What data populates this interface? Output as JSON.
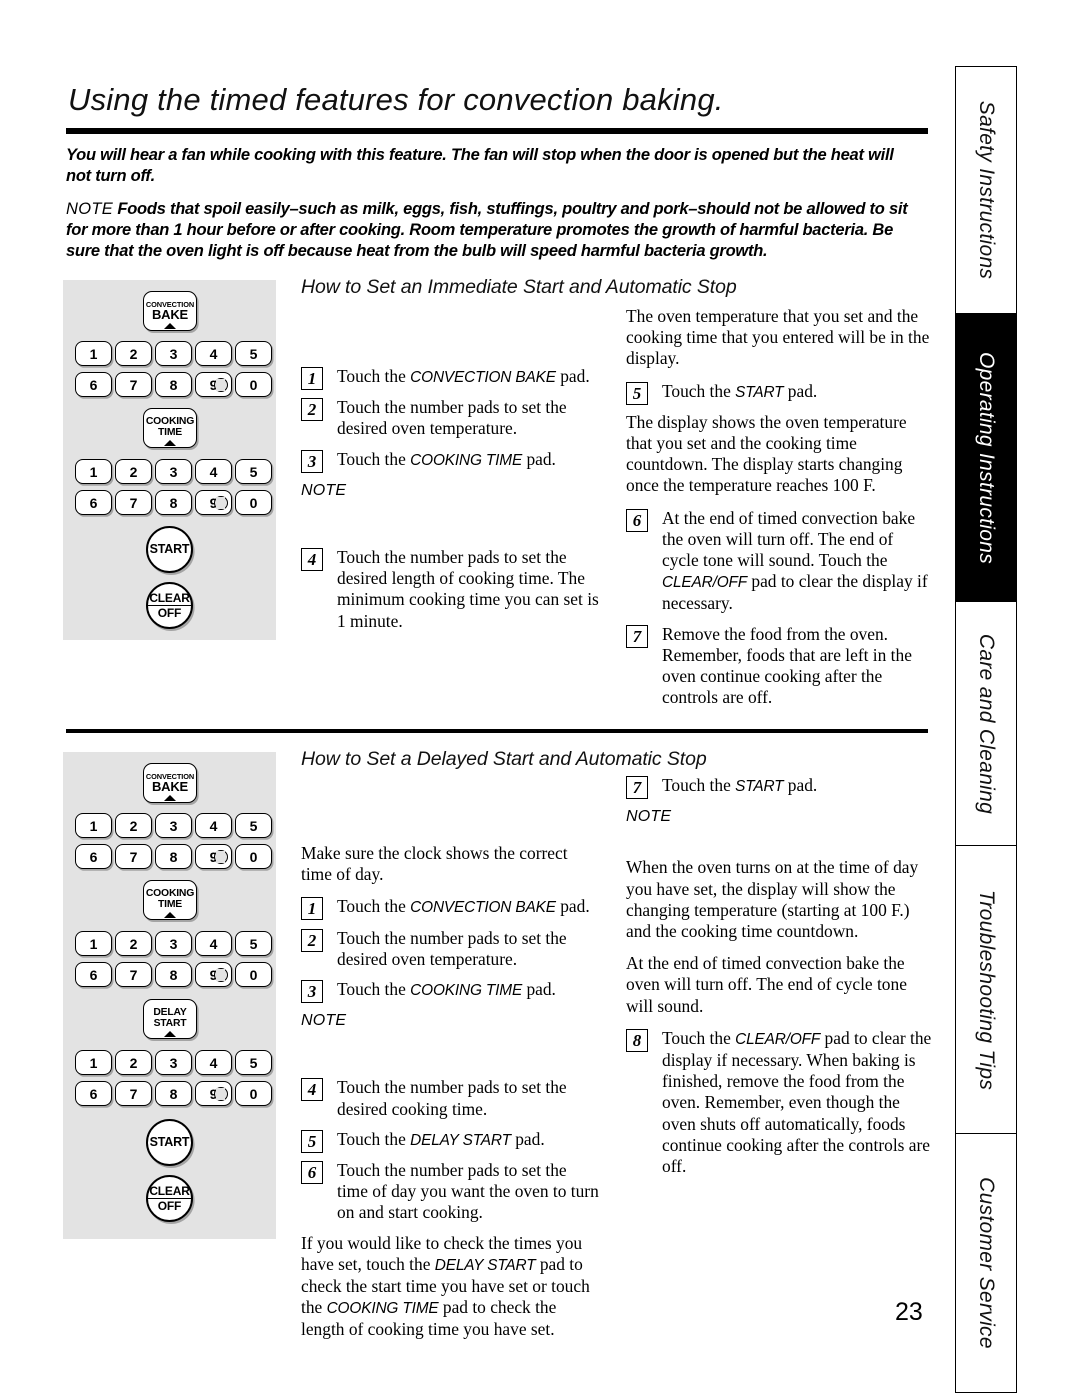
{
  "page": {
    "title": "Using the timed features for convection baking.",
    "number": "23"
  },
  "intro": {
    "paragraph1": "You will hear a fan while cooking with this feature. The fan will stop when the door is opened but the heat will not turn off.",
    "note_label": "NOTE",
    "paragraph2": "Foods that spoil easily–such as milk, eggs, fish, stuffings, poultry and pork–should not be allowed to sit for more than 1 hour before or after cooking. Room temperature promotes the growth of harmful bacteria. Be sure that the oven light is off because heat from the bulb will speed harmful bacteria growth."
  },
  "section1": {
    "heading": "How to Set an Immediate Start and Automatic Stop",
    "note_label": "NOTE",
    "steps_left": [
      {
        "num": "1",
        "pre": "Touch the ",
        "pad": "CONVECTION BAKE",
        "post": " pad."
      },
      {
        "num": "2",
        "pre": "Touch the number pads to set the desired oven temperature.",
        "pad": "",
        "post": ""
      },
      {
        "num": "3",
        "pre": "Touch the ",
        "pad": "COOKING TIME",
        "post": " pad."
      },
      {
        "num": "4",
        "pre": "Touch the number pads to set the desired length of cooking time. The minimum cooking time you can set is 1 minute.",
        "pad": "",
        "post": ""
      }
    ],
    "right_intro": "The oven temperature that you set and the cooking time that you entered will be in the display.",
    "step5": {
      "num": "5",
      "pre": "Touch the ",
      "pad": "START",
      "post": " pad."
    },
    "right_para2": "The display shows the oven temperature that you set and the cooking time countdown. The display starts changing once the temperature reaches 100  F.",
    "step6": {
      "num": "6",
      "pre": "At the end of timed convection bake the oven will turn off. The end of cycle tone will sound. Touch the ",
      "pad": "CLEAR/OFF",
      "post": " pad to clear the display if necessary."
    },
    "step7": {
      "num": "7",
      "pre": "Remove the food from the oven. Remember, foods that are left in the oven continue cooking after the controls are off.",
      "pad": "",
      "post": ""
    }
  },
  "section2": {
    "heading": "How to Set a Delayed Start and Automatic Stop",
    "note_label": "NOTE",
    "clock_para": "Make sure the clock shows the correct time of day.",
    "steps_left": [
      {
        "num": "1",
        "pre": "Touch the ",
        "pad": "CONVECTION BAKE",
        "post": " pad."
      },
      {
        "num": "2",
        "pre": "Touch the number pads to set the desired oven temperature.",
        "pad": "",
        "post": ""
      },
      {
        "num": "3",
        "pre": "Touch the ",
        "pad": "COOKING TIME",
        "post": " pad."
      },
      {
        "num": "4",
        "pre": "Touch the number pads to set the desired cooking time.",
        "pad": "",
        "post": ""
      },
      {
        "num": "5",
        "pre": "Touch the ",
        "pad": "DELAY START",
        "post": " pad."
      },
      {
        "num": "6",
        "pre": "Touch the number pads to set the time of day you want the oven to turn on and start cooking.",
        "pad": "",
        "post": ""
      }
    ],
    "check_para_1": "If you would like to check the times you have set, touch the ",
    "check_pad_1": "DELAY START",
    "check_para_2": " pad to check the start time you have set or touch the ",
    "check_pad_2": "COOKING TIME",
    "check_para_3": " pad to check the length of cooking time you have set.",
    "step7": {
      "num": "7",
      "pre": "Touch the ",
      "pad": "START",
      "post": " pad."
    },
    "right_para1": "When the oven turns on at the time of day you have set, the display will show the changing temperature (starting at 100  F.) and the cooking time countdown.",
    "right_para2": "At the end of timed convection bake the oven will turn off. The end of cycle tone will sound.",
    "step8": {
      "num": "8",
      "pre": "Touch the ",
      "pad": "CLEAR/OFF",
      "post": " pad to clear the display if necessary. When baking is finished, remove the food from the oven. Remember, even though the oven shuts off automatically, foods continue cooking after the controls are off."
    }
  },
  "control_panel_1": {
    "function_keys": [
      {
        "line1": "CONVECTION",
        "line2": "BAKE"
      },
      {
        "line1": "COOKING",
        "line2": "TIME"
      }
    ],
    "keypad_rows": [
      [
        "1",
        "2",
        "3",
        "4",
        "5"
      ],
      [
        "6",
        "7",
        "8",
        "9",
        "0"
      ]
    ],
    "start_label": "START",
    "clear_label_top": "CLEAR",
    "clear_label_bottom": "OFF"
  },
  "control_panel_2": {
    "function_keys": [
      {
        "line1": "CONVECTION",
        "line2": "BAKE"
      },
      {
        "line1": "COOKING",
        "line2": "TIME"
      },
      {
        "line1": "DELAY",
        "line2": "START"
      }
    ],
    "keypad_rows": [
      [
        "1",
        "2",
        "3",
        "4",
        "5"
      ],
      [
        "6",
        "7",
        "8",
        "9",
        "0"
      ]
    ],
    "start_label": "START",
    "clear_label_top": "CLEAR",
    "clear_label_bottom": "OFF"
  },
  "tabs": [
    {
      "label": "Safety Instructions",
      "active": false
    },
    {
      "label": "Operating Instructions",
      "active": true
    },
    {
      "label": "Care and Cleaning",
      "active": false
    },
    {
      "label": "Troubleshooting Tips",
      "active": false
    },
    {
      "label": "Customer Service",
      "active": false
    }
  ]
}
